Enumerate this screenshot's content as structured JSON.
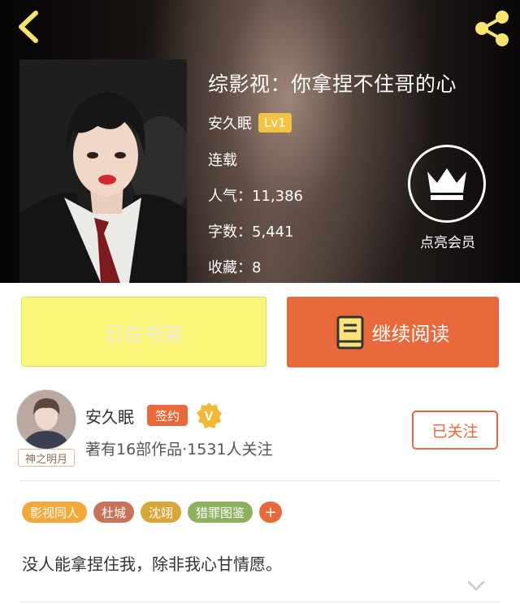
{
  "book": {
    "title": "综影视：你拿捏不住哥的心",
    "author": "安久眠",
    "level": "Lv1",
    "status": "连载",
    "popularity_label": "人气：11,386",
    "word_count_label": "字数：5,441",
    "favorites_label": "收藏：8"
  },
  "vip": {
    "label": "点亮会员"
  },
  "actions": {
    "shelf_label": "已在书架",
    "read_label": "继续阅读"
  },
  "author_card": {
    "name": "安久眠",
    "sign_badge": "签约",
    "verified_icon": "v-badge-icon",
    "avatar_tag": "神之明月",
    "stats": "著有16部作品·1531人关注",
    "follow_label": "已关注"
  },
  "tags": [
    {
      "label": "影视同人",
      "color": "#f2a93b"
    },
    {
      "label": "杜城",
      "color": "#c9725a"
    },
    {
      "label": "沈翊",
      "color": "#d8a63a"
    },
    {
      "label": "猎罪图鉴",
      "color": "#8fb05c"
    }
  ],
  "tag_more": "+",
  "summary": "没人能拿捏住我，除非我心甘情愿。",
  "colors": {
    "accent": "#e8693c",
    "shelf_button": "#fbf57a",
    "level_badge": "#f5c343",
    "icon_yellow": "#f6e46c"
  }
}
